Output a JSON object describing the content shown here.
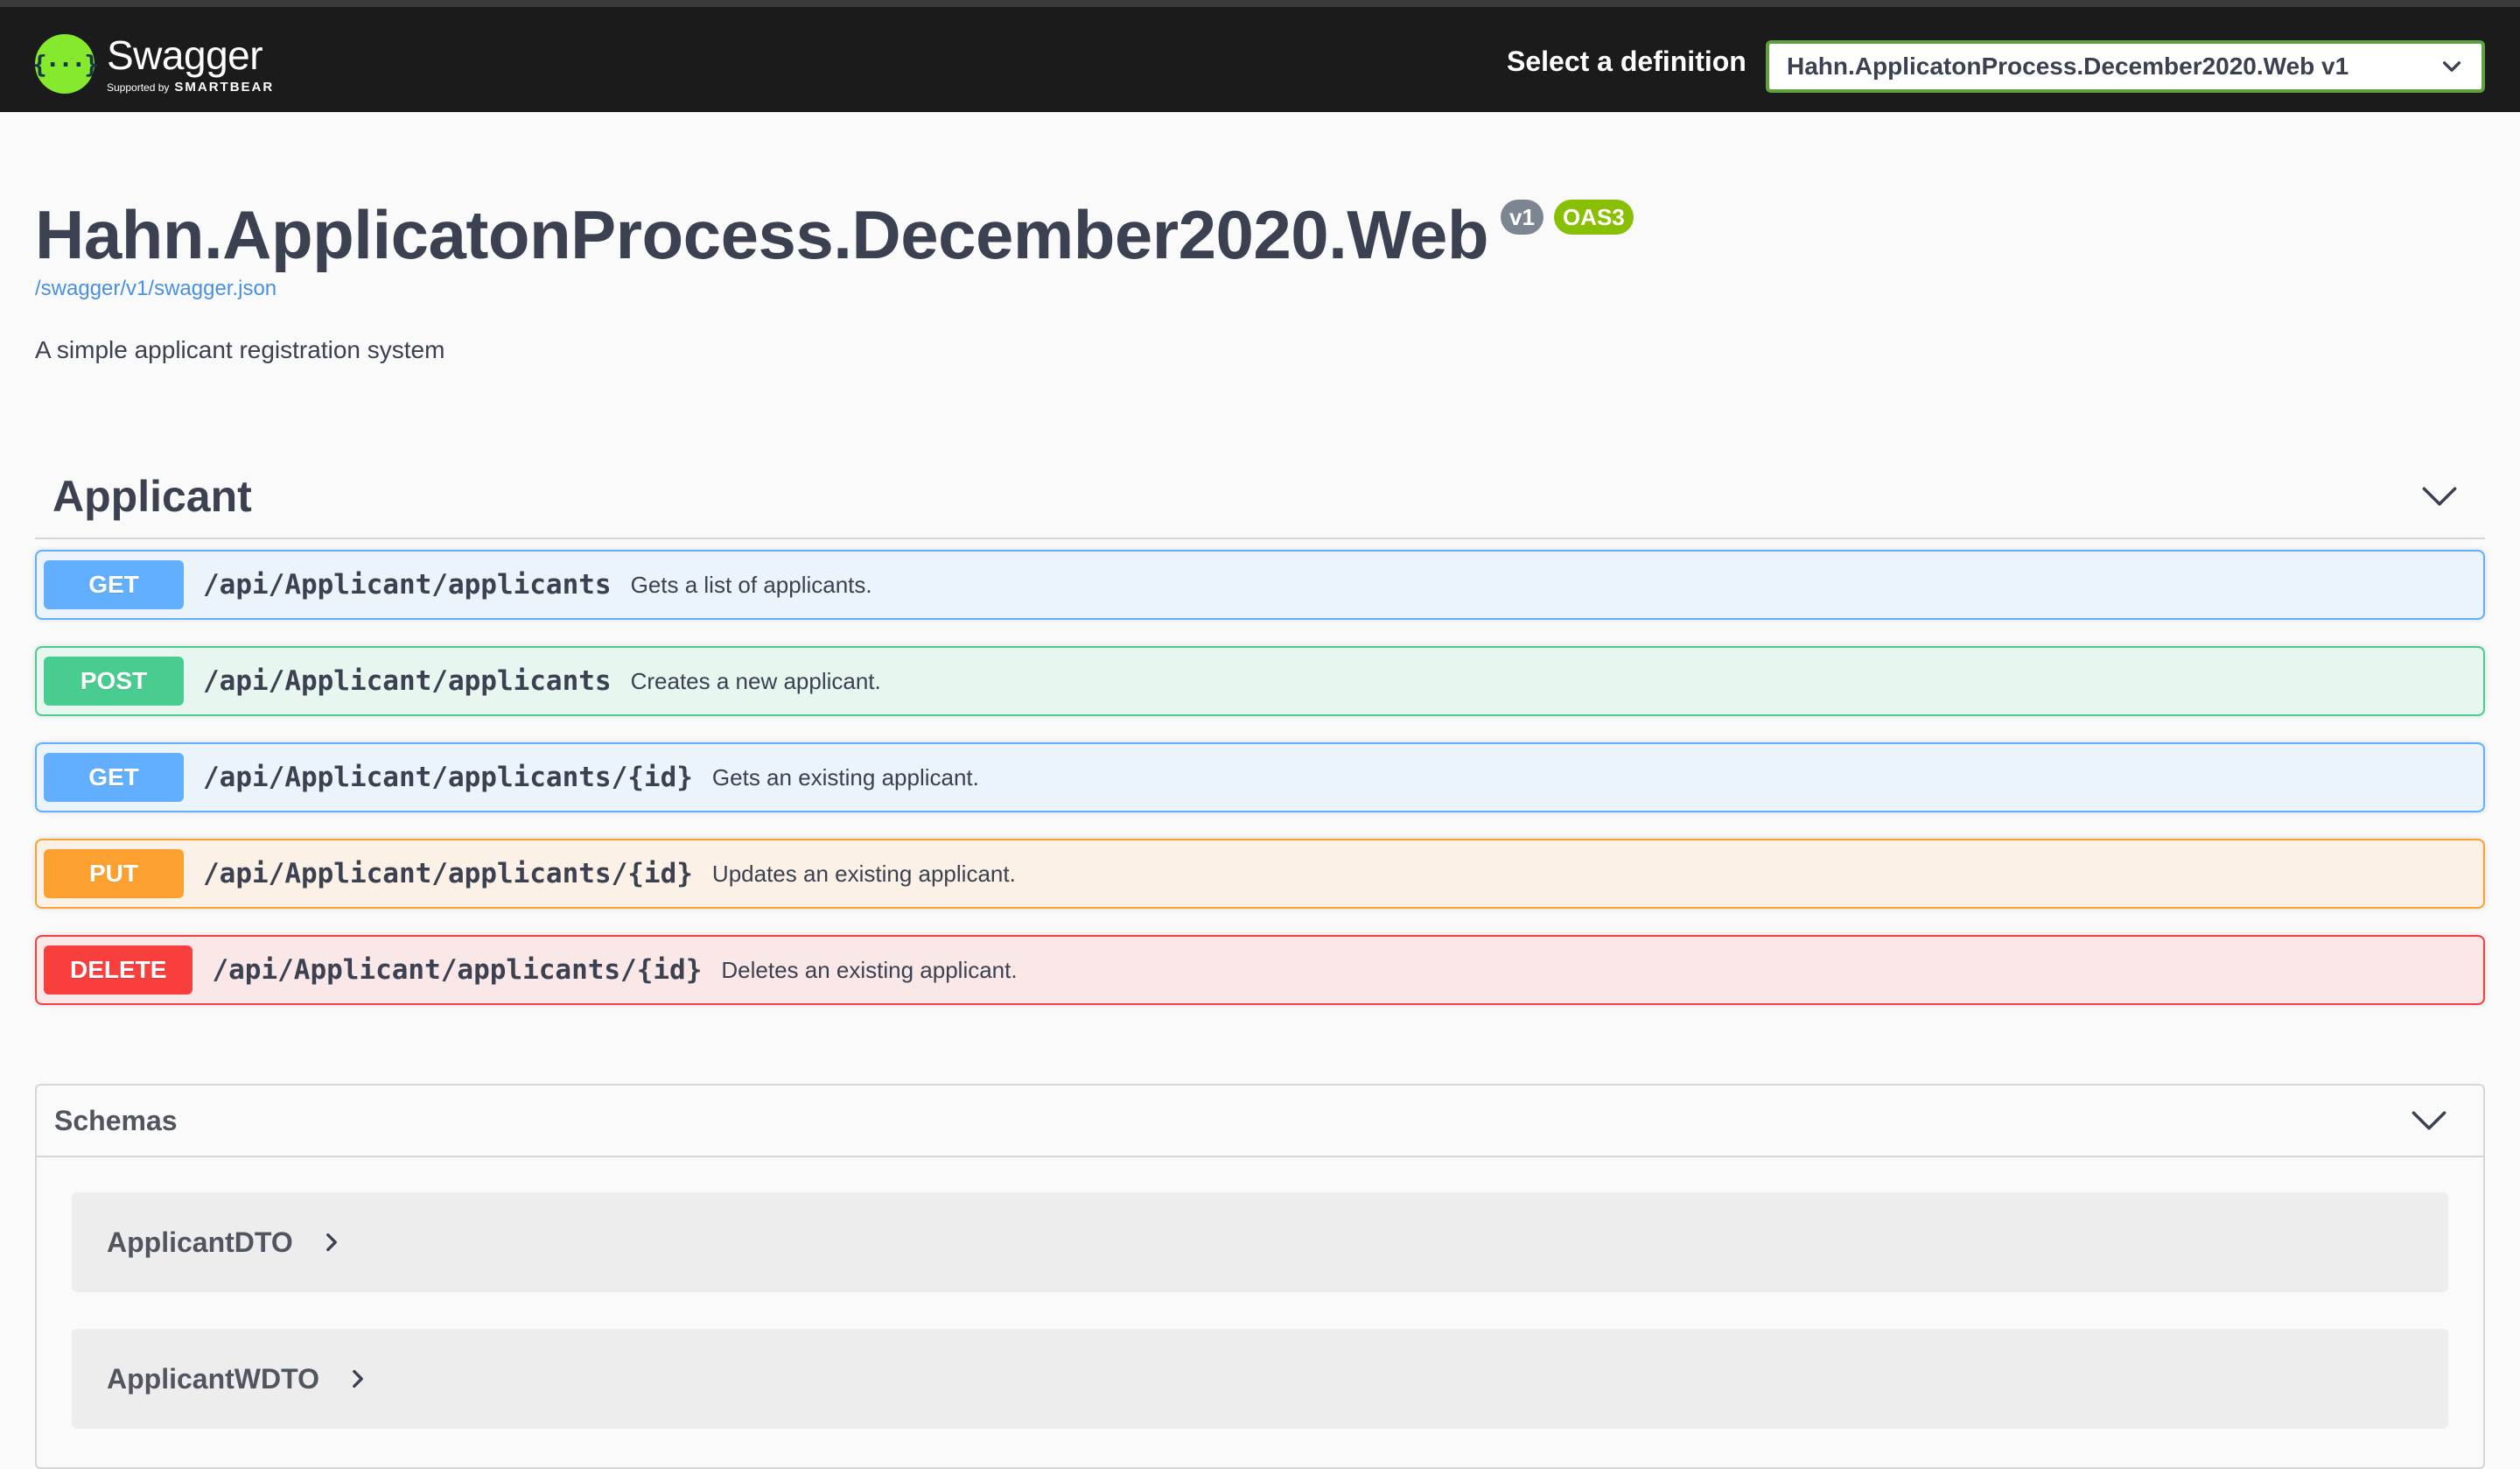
{
  "topbar": {
    "logo_title": "Swagger",
    "logo_supported": "Supported by",
    "logo_brand": "SMARTBEAR",
    "logo_glyph": "{···}",
    "definition_label": "Select a definition",
    "definition_selected": "Hahn.ApplicatonProcess.December2020.Web v1",
    "icon": "chevron-down-icon"
  },
  "info": {
    "title": "Hahn.ApplicatonProcess.December2020.Web",
    "version_badge": "v1",
    "oas_badge": "OAS3",
    "spec_url": "/swagger/v1/swagger.json",
    "description": "A simple applicant registration system"
  },
  "tag": {
    "name": "Applicant",
    "icon": "chevron-down-icon"
  },
  "operations": [
    {
      "method": "GET",
      "path": "/api/Applicant/applicants",
      "summary": "Gets a list of applicants."
    },
    {
      "method": "POST",
      "path": "/api/Applicant/applicants",
      "summary": "Creates a new applicant."
    },
    {
      "method": "GET",
      "path": "/api/Applicant/applicants/{id}",
      "summary": "Gets an existing applicant."
    },
    {
      "method": "PUT",
      "path": "/api/Applicant/applicants/{id}",
      "summary": "Updates an existing applicant."
    },
    {
      "method": "DELETE",
      "path": "/api/Applicant/applicants/{id}",
      "summary": "Deletes an existing applicant."
    }
  ],
  "schemas": {
    "title": "Schemas",
    "icon": "chevron-down-icon",
    "models": [
      {
        "name": "ApplicantDTO",
        "icon": "chevron-right-icon"
      },
      {
        "name": "ApplicantWDTO",
        "icon": "chevron-right-icon"
      }
    ]
  },
  "colors": {
    "get": "#61affe",
    "post": "#49cc90",
    "put": "#fca130",
    "delete": "#f93e3e",
    "topbar": "#1b1b1b",
    "select_border": "#62a03f",
    "logo": "#85ea2d"
  }
}
